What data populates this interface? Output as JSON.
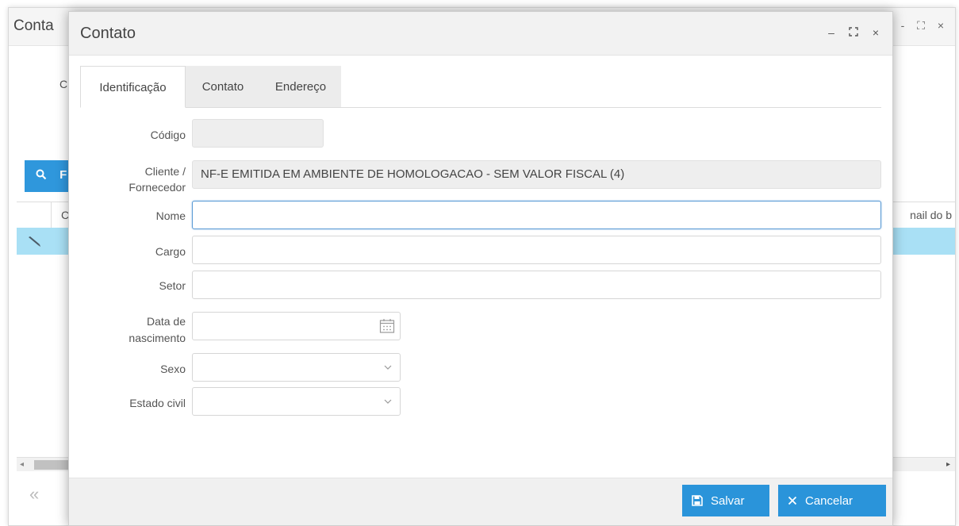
{
  "background_window": {
    "title": "Conta",
    "controls": "- ⛶ ×",
    "label_partial": "Cl",
    "search_button_partial": "F",
    "grid_header_partial": "C",
    "grid_header_email_partial": "nail do b",
    "pager_first": "«",
    "scroll_left": "◂",
    "scroll_right": "▸"
  },
  "dialog": {
    "title": "Contato",
    "controls": {
      "minimize": "–",
      "maximize": "⛶",
      "close": "×"
    },
    "tabs": [
      {
        "label": "Identificação",
        "active": true
      },
      {
        "label": "Contato",
        "active": false
      },
      {
        "label": "Endereço",
        "active": false
      }
    ],
    "form": {
      "codigo": {
        "label": "Código",
        "value": ""
      },
      "cliente": {
        "label_line1": "Cliente /",
        "label_line2": "Fornecedor",
        "value": "NF-E EMITIDA EM AMBIENTE DE HOMOLOGACAO - SEM VALOR FISCAL (4)"
      },
      "nome": {
        "label": "Nome",
        "value": ""
      },
      "cargo": {
        "label": "Cargo",
        "value": ""
      },
      "setor": {
        "label": "Setor",
        "value": ""
      },
      "data_nascimento": {
        "label_line1": "Data de",
        "label_line2": "nascimento",
        "value": ""
      },
      "sexo": {
        "label": "Sexo",
        "value": ""
      },
      "estado_civil": {
        "label": "Estado civil",
        "value": ""
      }
    },
    "footer": {
      "save_label": "Salvar",
      "cancel_label": "Cancelar"
    }
  },
  "colors": {
    "primary_button": "#2a94da",
    "selected_row": "#a9e0f5",
    "focus_border": "#5b9bd5"
  }
}
